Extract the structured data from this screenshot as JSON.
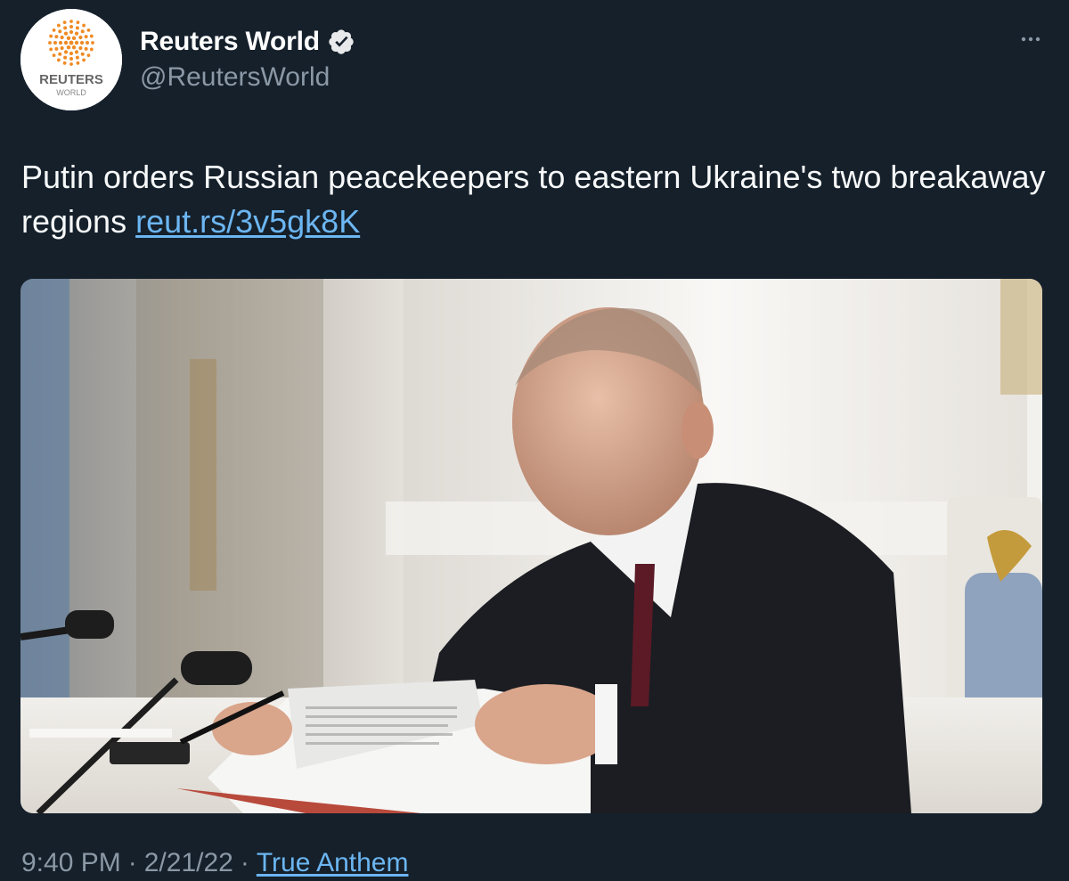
{
  "author": {
    "display_name": "Reuters World",
    "handle": "@ReutersWorld",
    "verified": true,
    "avatar": {
      "brand_text": "REUTERS",
      "sub_text": "WORLD",
      "logo_color": "#f08a24"
    }
  },
  "tweet": {
    "text": "Putin orders Russian peacekeepers to eastern Ukraine's two breakaway regions ",
    "link_text": "reut.rs/3v5gk8K"
  },
  "media": {
    "type": "photo"
  },
  "meta": {
    "time": "9:40 PM",
    "date": "2/21/22",
    "separator": "·",
    "source": "True Anthem"
  },
  "colors": {
    "background": "#15202b",
    "link": "#6cb6f2",
    "muted_text": "#8b98a5",
    "verified_badge": "#e7e9ea"
  },
  "icons": {
    "verified": "verified-badge-icon",
    "more": "more-options-icon"
  }
}
